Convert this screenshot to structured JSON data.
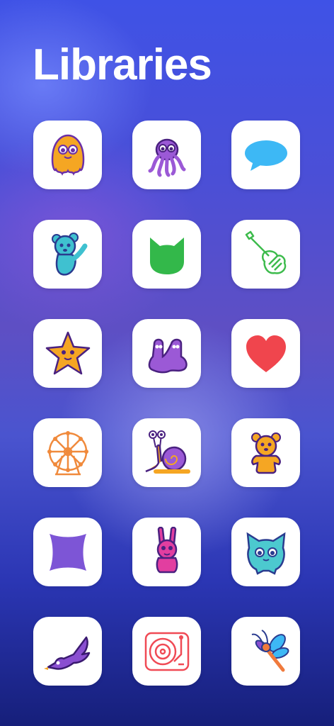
{
  "header": {
    "title": "Libraries"
  },
  "libraries": [
    {
      "icon": "orange-ghost-monster-icon",
      "color": "#f5a623"
    },
    {
      "icon": "purple-octopus-icon",
      "color": "#9b59d6"
    },
    {
      "icon": "speech-bubble-icon",
      "color": "#3db8f5"
    },
    {
      "icon": "teal-bear-icon",
      "color": "#3fc1d0"
    },
    {
      "icon": "green-cat-head-icon",
      "color": "#33b84a"
    },
    {
      "icon": "guitar-icon",
      "color": "#3dbb4c"
    },
    {
      "icon": "orange-star-icon",
      "color": "#f5a623"
    },
    {
      "icon": "purple-blob-monster-icon",
      "color": "#9b59d6"
    },
    {
      "icon": "red-heart-icon",
      "color": "#f0454d"
    },
    {
      "icon": "ferris-wheel-icon",
      "color": "#f08a3c"
    },
    {
      "icon": "snail-icon",
      "color": "#f5a623"
    },
    {
      "icon": "orange-bear-icon",
      "color": "#f5a623"
    },
    {
      "icon": "purple-squircle-icon",
      "color": "#7d55d6"
    },
    {
      "icon": "pink-bunny-icon",
      "color": "#e23ea0"
    },
    {
      "icon": "teal-cat-creature-icon",
      "color": "#4cc9cf"
    },
    {
      "icon": "purple-bird-icon",
      "color": "#8a4fd1"
    },
    {
      "icon": "turntable-icon",
      "color": "#f04a55"
    },
    {
      "icon": "dragonfly-icon",
      "color": "#f07a3c"
    }
  ]
}
